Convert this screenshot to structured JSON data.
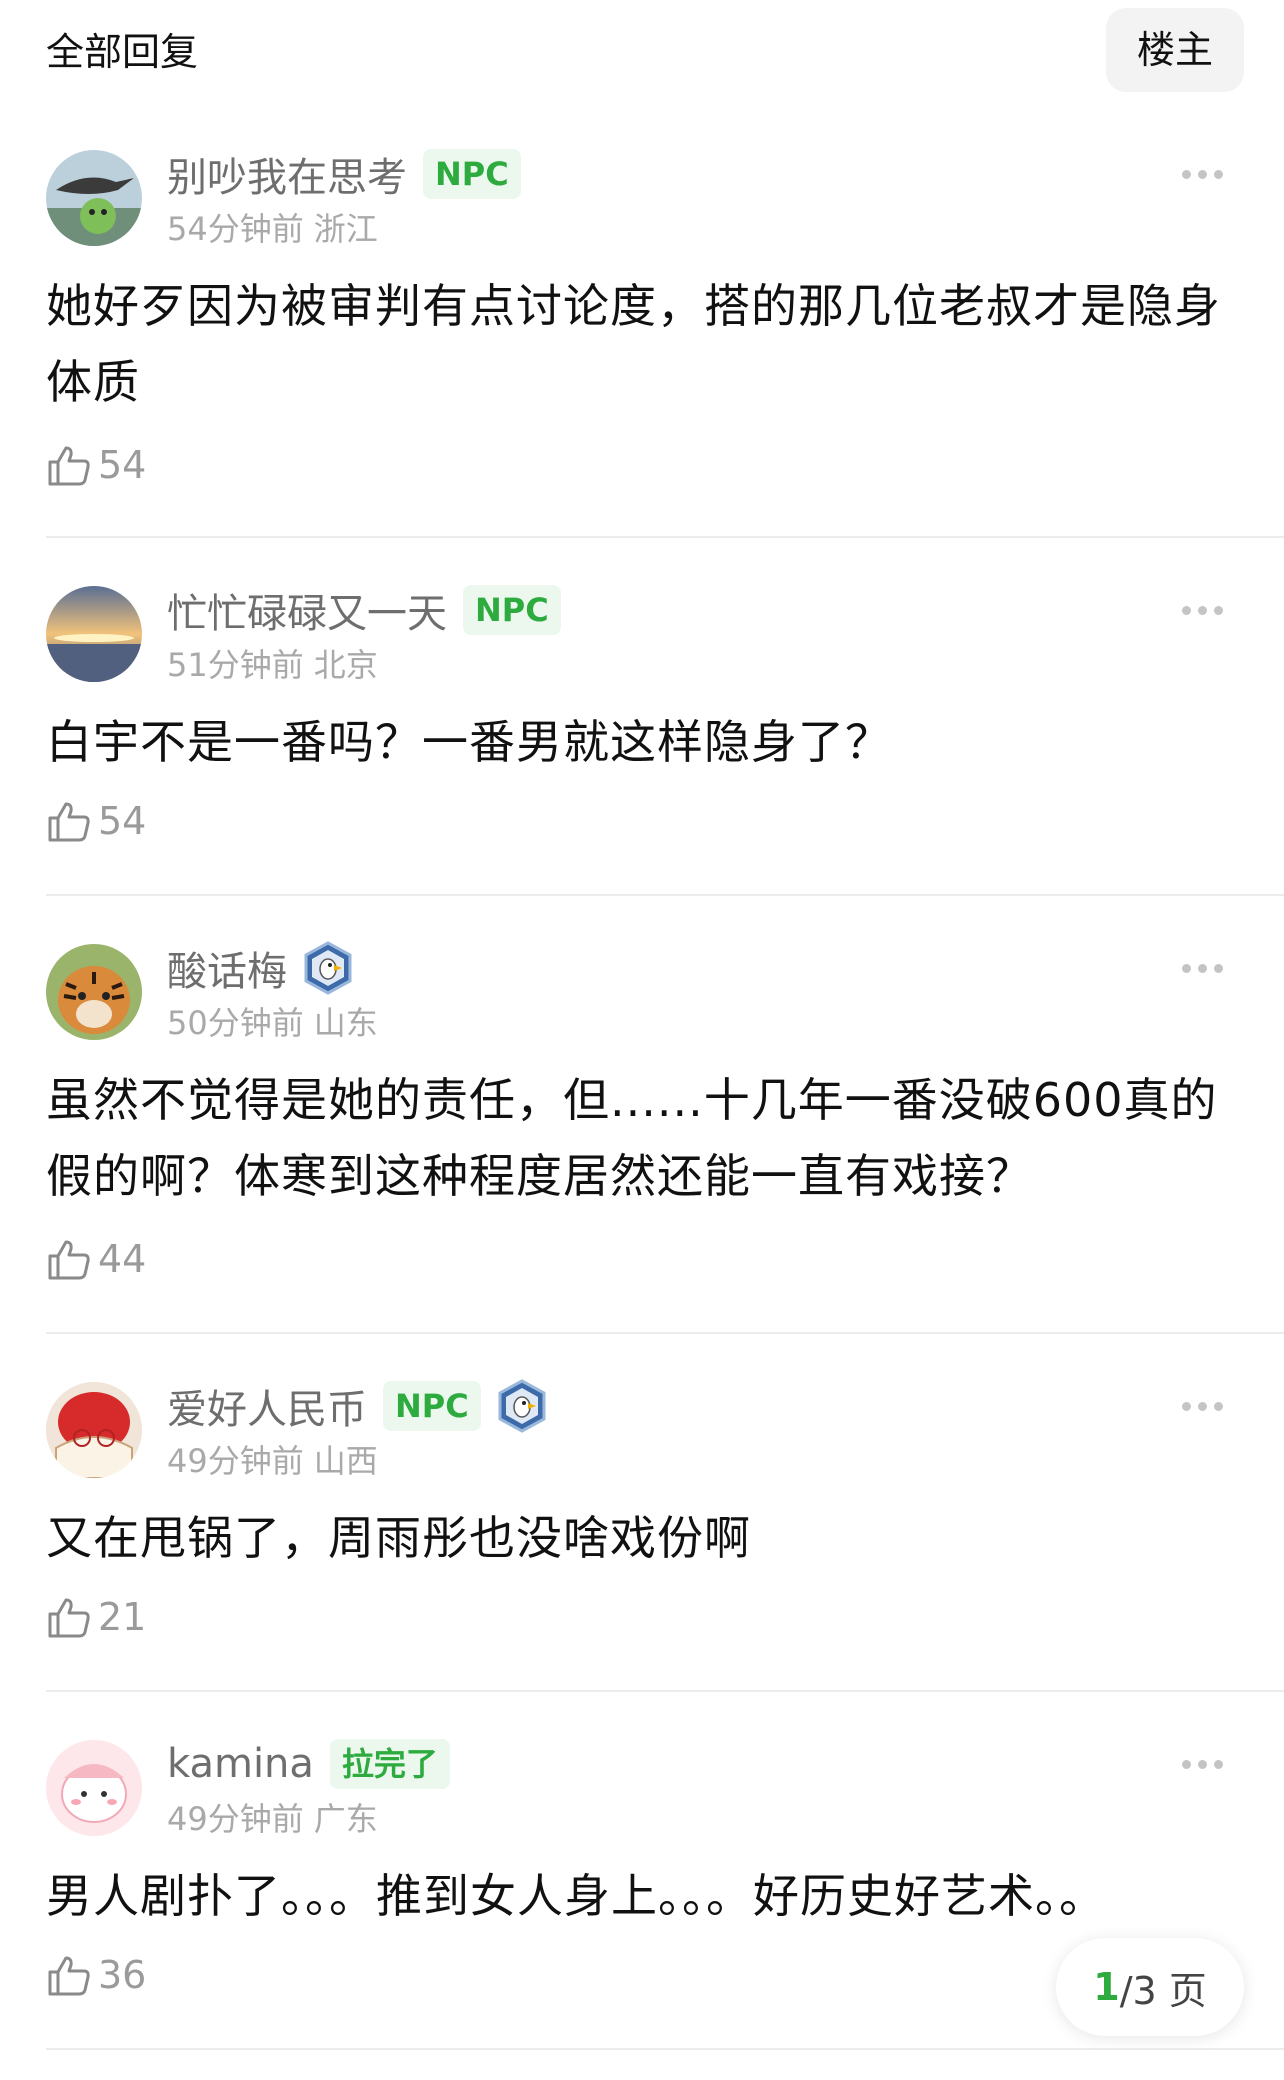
{
  "header": {
    "title": "全部回复",
    "op_button": "楼主"
  },
  "comments": [
    {
      "username": "别吵我在思考",
      "tag": "NPC",
      "time": "54分钟前",
      "location": "浙江",
      "text": "她好歹因为被审判有点讨论度，搭的那几位老叔才是隐身体质",
      "likes": "54",
      "avatar_icon": "goose-avatar-icon"
    },
    {
      "username": "忙忙碌碌又一天",
      "tag": "NPC",
      "time": "51分钟前",
      "location": "北京",
      "text": "白宇不是一番吗？一番男就这样隐身了？",
      "likes": "54",
      "avatar_icon": "sunset-avatar-icon"
    },
    {
      "username": "酸话梅",
      "tag": "",
      "badge": "eagle-badge-icon",
      "time": "50分钟前",
      "location": "山东",
      "text": "虽然不觉得是她的责任，但......十几年一番没破600真的假的啊？体寒到这种程度居然还能一直有戏接？",
      "likes": "44",
      "avatar_icon": "tiger-avatar-icon"
    },
    {
      "username": "爱好人民币",
      "tag": "NPC",
      "badge": "eagle-badge-icon",
      "time": "49分钟前",
      "location": "山西",
      "text": "又在甩锅了，周雨彤也没啥戏份啊",
      "likes": "21",
      "avatar_icon": "strawberry-avatar-icon"
    },
    {
      "username": "kamina",
      "tag": "拉完了",
      "time": "49分钟前",
      "location": "广东",
      "text": "男人剧扑了。。。推到女人身上。。。好历史好艺术。。",
      "likes": "36",
      "avatar_icon": "cartoon-avatar-icon"
    }
  ],
  "pager": {
    "current": "1",
    "total": "/3 页"
  },
  "colors": {
    "accent": "#2dab3f",
    "tag_bg": "#ecf8ee",
    "meta": "#a9a9a9",
    "divider": "#ececec"
  }
}
